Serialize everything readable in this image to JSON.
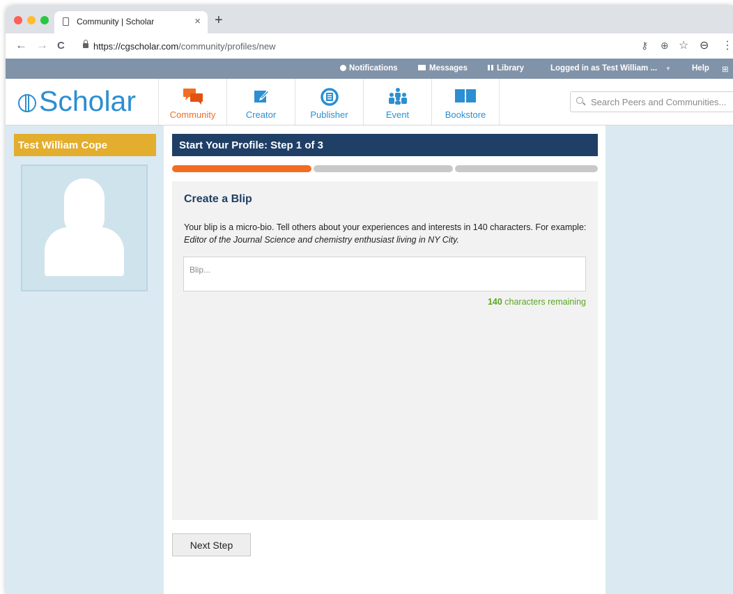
{
  "browser": {
    "tab_title": "Community | Scholar",
    "tab_close": "×",
    "new_tab": "+",
    "back": "←",
    "forward": "→",
    "reload": "C",
    "url_host": "https://cgscholar.com",
    "url_path": "/community/profiles/new",
    "key": "⚷",
    "zoom": "⊕",
    "star": "☆",
    "account": "⊖",
    "menu": "⋮"
  },
  "topbar": {
    "notifications": "Notifications",
    "messages": "Messages",
    "library": "Library",
    "logged_in": "Logged in as Test William ...",
    "help": "Help"
  },
  "header": {
    "logo": "Scholar",
    "nav": [
      {
        "label": "Community",
        "active": true
      },
      {
        "label": "Creator"
      },
      {
        "label": "Publisher"
      },
      {
        "label": "Event"
      },
      {
        "label": "Bookstore"
      }
    ],
    "search_placeholder": "Search Peers and Communities..."
  },
  "sidebar": {
    "name": "Test William Cope"
  },
  "main": {
    "step_title": "Start Your Profile: Step 1 of 3",
    "progress_steps": 3,
    "progress_completed": 1,
    "card_title": "Create a Blip",
    "desc_intro": "Your blip is a micro-bio. Tell others about your experiences and interests in 140 characters. For example: ",
    "desc_example": "Editor of the Journal Science and chemistry enthusiast living in NY City.",
    "blip_placeholder": "Blip...",
    "remaining_count": "140",
    "remaining_label": " characters remaining",
    "next_button": "Next Step"
  },
  "colors": {
    "accent_orange": "#f26d21",
    "brand_blue": "#2b8fd1",
    "step_bar": "#1f3f66",
    "name_bar": "#e3ad2e",
    "remaining_green": "#59a822"
  }
}
